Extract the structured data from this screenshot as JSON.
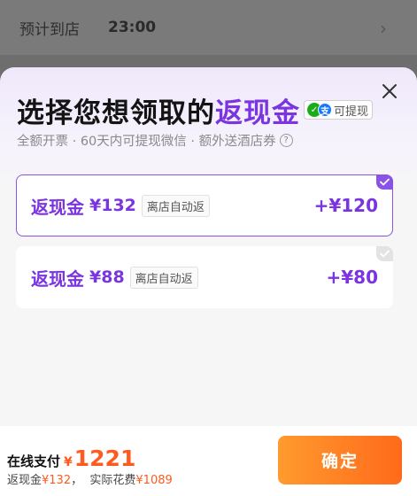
{
  "background_row": {
    "label": "预计到店",
    "value": "23:00"
  },
  "sheet": {
    "title_prefix": "选择您想领取的",
    "title_accent": "返现金",
    "badge_text": "可提现",
    "subtitle": "全额开票 · 60天内可提现微信 · 额外送酒店券"
  },
  "options": [
    {
      "name": "返现金",
      "amount": "¥132",
      "tag": "离店自动返",
      "reward": "+¥120",
      "selected": true
    },
    {
      "name": "返现金",
      "amount": "¥88",
      "tag": "离店自动返",
      "reward": "+¥80",
      "selected": false
    }
  ],
  "footer": {
    "pay_label": "在线支付",
    "currency": "¥",
    "total": "1221",
    "cashback_label": "返现金",
    "cashback_value": "¥132",
    "separator": "，",
    "actual_label": "实际花费",
    "actual_value": "¥1089",
    "confirm_label": "确定"
  },
  "colors": {
    "accent": "#7a35e0",
    "orange": "#ff5a1f"
  }
}
